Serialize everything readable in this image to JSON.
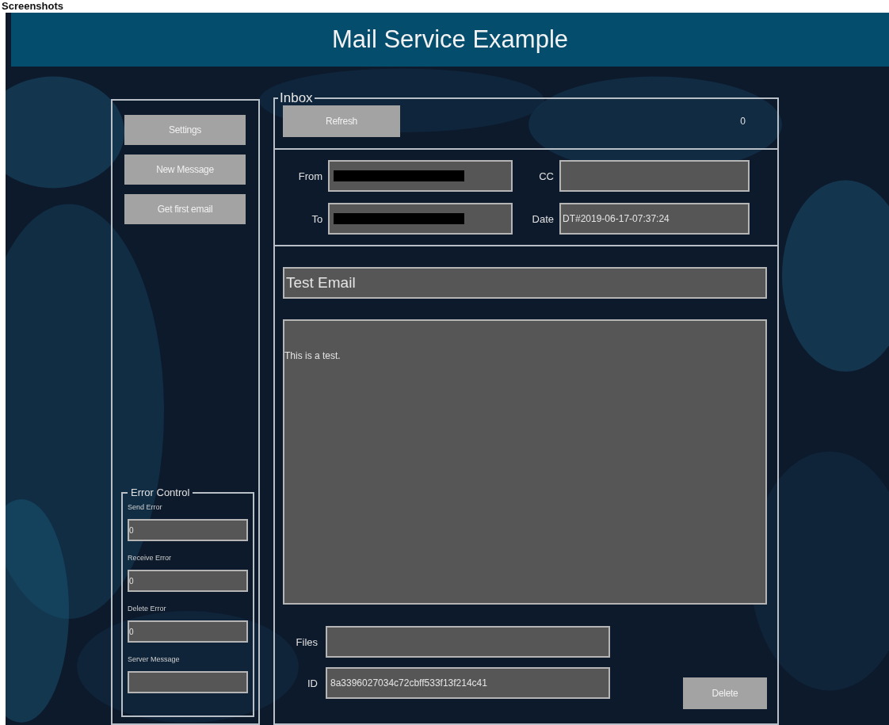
{
  "page_heading": "Screenshots",
  "title": "Mail Service Example",
  "sidebar": {
    "buttons": [
      "Settings",
      "New Message",
      "Get first email"
    ],
    "error_control": {
      "title": "Error Control",
      "fields": [
        {
          "label": "Send Error",
          "value": "0"
        },
        {
          "label": "Receive Error",
          "value": "0"
        },
        {
          "label": "Delete Error",
          "value": "0"
        },
        {
          "label": "Server Message"
        }
      ]
    }
  },
  "inbox": {
    "title": "Inbox",
    "refresh_button": "Refresh",
    "count": "0",
    "header_fields": [
      {
        "label": "From",
        "redacted": true
      },
      {
        "label": "CC",
        "redacted": false
      },
      {
        "label": "To",
        "redacted": true
      },
      {
        "label": "Date",
        "redacted": false,
        "value": "DT#2019-06-17-07:37:24"
      }
    ],
    "subject": "Test Email",
    "body": "This is a test.",
    "files": {
      "label": "Files"
    },
    "id": {
      "label": "ID",
      "value": "8a3396027034c72cbff533f13f214c41"
    },
    "delete_button": "Delete"
  }
}
